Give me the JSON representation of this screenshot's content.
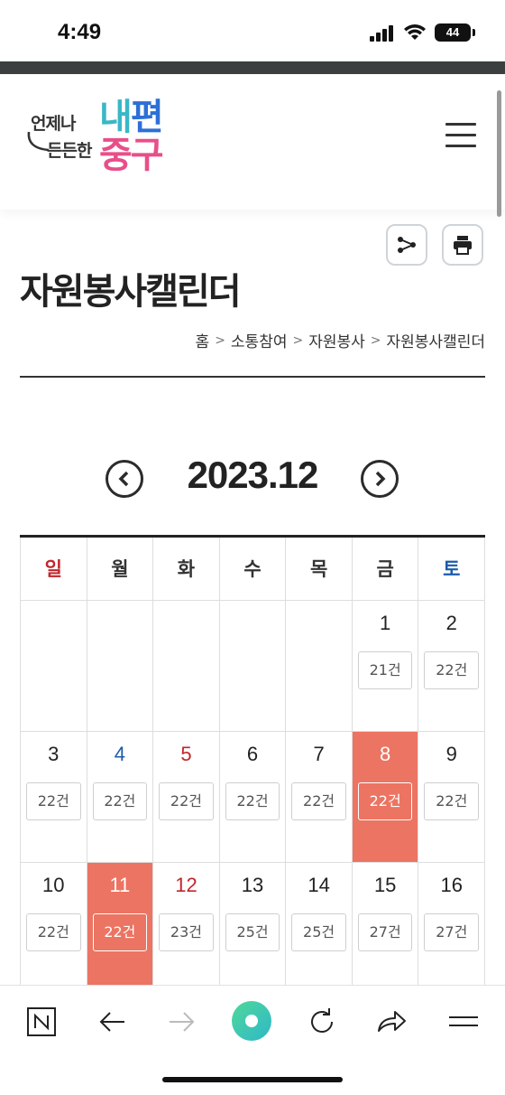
{
  "status_bar": {
    "time": "4:49",
    "battery": "44"
  },
  "header": {
    "logo": {
      "line1": "언제나",
      "line2": "든든한",
      "big1": "내",
      "big1b": "편",
      "big2": "중구"
    }
  },
  "page": {
    "title": "자원봉사캘린더",
    "breadcrumb": [
      "홈",
      "소통참여",
      "자원봉사",
      "자원봉사캘린더"
    ]
  },
  "calendar": {
    "month_label": "2023.12",
    "weekdays": [
      "일",
      "월",
      "화",
      "수",
      "목",
      "금",
      "토"
    ],
    "weeks": [
      [
        null,
        null,
        null,
        null,
        null,
        {
          "day": "1",
          "count": "21건"
        },
        {
          "day": "2",
          "count": "22건"
        }
      ],
      [
        {
          "day": "3",
          "count": "22건"
        },
        {
          "day": "4",
          "count": "22건"
        },
        {
          "day": "5",
          "count": "22건"
        },
        {
          "day": "6",
          "count": "22건"
        },
        {
          "day": "7",
          "count": "22건"
        },
        {
          "day": "8",
          "count": "22건"
        },
        {
          "day": "9",
          "count": "22건"
        }
      ],
      [
        {
          "day": "10",
          "count": "22건"
        },
        {
          "day": "11",
          "count": "22건"
        },
        {
          "day": "12",
          "count": "23건"
        },
        {
          "day": "13",
          "count": "25건"
        },
        {
          "day": "14",
          "count": "25건"
        },
        {
          "day": "15",
          "count": "27건"
        },
        {
          "day": "16",
          "count": "27건"
        }
      ]
    ]
  },
  "colors": {
    "accent": "#ec7462",
    "holiday_red": "#c0262d",
    "saturday_blue": "#1d5aa8"
  },
  "toolbar_icons": [
    "naver-n-icon",
    "back-arrow-icon",
    "forward-arrow-icon",
    "green-circle-icon",
    "refresh-icon",
    "share-arrow-icon",
    "menu-icon"
  ]
}
